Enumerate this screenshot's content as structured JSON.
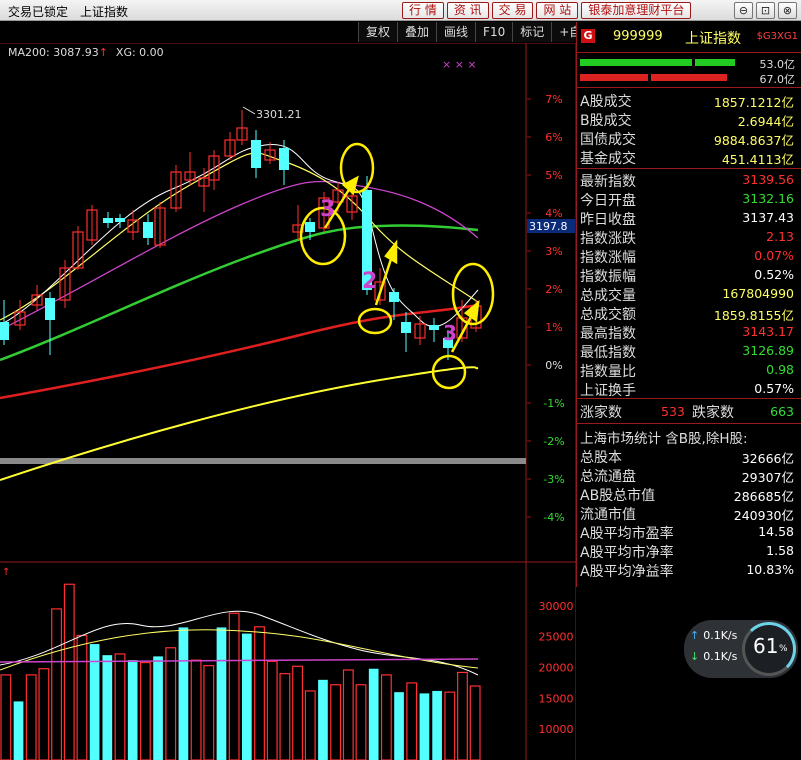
{
  "titlebar": {
    "lock_label": "交易已锁定",
    "window_title": "上证指数",
    "buttons": [
      "行 情",
      "资 讯",
      "交 易",
      "网 站",
      "银泰加意理财平台"
    ],
    "controls": [
      "⊖",
      "⊡",
      "⊗"
    ]
  },
  "toolbar": {
    "items": [
      "复权",
      "叠加",
      "画线",
      "F10",
      "标记",
      "+自选"
    ]
  },
  "ma_legend": {
    "ma200": "MA200: 3087.93",
    "ma200_arrow": "↑",
    "xg": "XG: 0.00"
  },
  "price_chart": {
    "y_labels": [
      "7%",
      "6%",
      "5%",
      "4%",
      "3%",
      "2%",
      "1%",
      "0%",
      "-1%",
      "-2%",
      "-3%",
      "-4%"
    ],
    "y_values": [
      7,
      6,
      5,
      4,
      3,
      2,
      1,
      0,
      -1,
      -2,
      -3,
      -4
    ],
    "high_label": "3301.21",
    "current_marker": "3197.8",
    "annotations": [
      "3",
      "2",
      "3"
    ],
    "markers": "× × ×",
    "colors": {
      "up": "#ff3030",
      "down": "#54ffff",
      "ma5": "#ffffff",
      "ma10": "#ffff66",
      "ma20": "#cc44cc",
      "ma60": "#33cc33",
      "ma120": "#e02020",
      "ma200": "#ffff33",
      "annotation": "#ffee00"
    }
  },
  "chart_data": [
    {
      "type": "bar",
      "title": "",
      "y_axis_ticks": [
        "30000",
        "25000",
        "20000",
        "15000",
        "10000"
      ],
      "ylim": [
        5000,
        35000
      ],
      "values": [
        18800,
        14500,
        18800,
        19800,
        29500,
        33500,
        25200,
        23800,
        22000,
        22200,
        21200,
        20800,
        21800,
        23200,
        26500,
        21200,
        20300,
        26500,
        28800,
        25500,
        26600,
        21000,
        19000,
        20200,
        16200,
        18000,
        17200,
        19600,
        17200,
        19800,
        18800,
        16000,
        17500,
        15800,
        16200,
        16000,
        19200,
        17000
      ],
      "colors": [
        "up",
        "down",
        "up",
        "up",
        "up",
        "up",
        "up",
        "down",
        "down",
        "up",
        "down",
        "up",
        "down",
        "up",
        "down",
        "up",
        "up",
        "down",
        "up",
        "down",
        "up",
        "up",
        "up",
        "up",
        "up",
        "down",
        "up",
        "up",
        "up",
        "down",
        "up",
        "down",
        "up",
        "down",
        "down",
        "up",
        "up",
        "up"
      ],
      "grid": false
    }
  ],
  "right_panel": {
    "code": "999999",
    "name": "上证指数",
    "badge": "G",
    "tag": "$G3XG1",
    "bar_values": [
      "53.0亿",
      "67.0亿"
    ],
    "rows_a": [
      {
        "label": "A股成交",
        "value": "1857.1212亿",
        "color": "#ffff66"
      },
      {
        "label": "B股成交",
        "value": "2.6944亿",
        "color": "#ffff66"
      },
      {
        "label": "国债成交",
        "value": "9884.8637亿",
        "color": "#ffff66"
      },
      {
        "label": "基金成交",
        "value": "451.4113亿",
        "color": "#ffff66"
      }
    ],
    "rows_b": [
      {
        "label": "最新指数",
        "value": "3139.56",
        "color": "#ff3030"
      },
      {
        "label": "今日开盘",
        "value": "3132.16",
        "color": "#33dd33"
      },
      {
        "label": "昨日收盘",
        "value": "3137.43",
        "color": "#ffffff"
      },
      {
        "label": "指数涨跌",
        "value": "2.13",
        "color": "#ff3030"
      },
      {
        "label": "指数涨幅",
        "value": "0.07%",
        "color": "#ff3030"
      },
      {
        "label": "指数振幅",
        "value": "0.52%",
        "color": "#ffffff"
      },
      {
        "label": "总成交量",
        "value": "167804990",
        "color": "#ffff66"
      },
      {
        "label": "总成交额",
        "value": "1859.8155亿",
        "color": "#ffff66"
      },
      {
        "label": "最高指数",
        "value": "3143.17",
        "color": "#ff3030"
      },
      {
        "label": "最低指数",
        "value": "3126.89",
        "color": "#33dd33"
      },
      {
        "label": "指数量比",
        "value": "0.98",
        "color": "#33dd33"
      },
      {
        "label": "上证换手",
        "value": "0.57%",
        "color": "#ffffff"
      }
    ],
    "advance_label": "涨家数",
    "advance_value": "533",
    "decline_label": "跌家数",
    "decline_value": "663",
    "market_title": "上海市场统计 含B股,除H股:",
    "rows_c": [
      {
        "label": "总股本",
        "value": "32666亿",
        "color": "#ffffff"
      },
      {
        "label": "总流通盘",
        "value": "29307亿",
        "color": "#ffffff"
      },
      {
        "label": "AB股总市值",
        "value": "286685亿",
        "color": "#ffffff"
      },
      {
        "label": "流通市值",
        "value": "240930亿",
        "color": "#ffffff"
      },
      {
        "label": "A股平均市盈率",
        "value": "14.58",
        "color": "#ffffff"
      },
      {
        "label": "A股平均市净率",
        "value": "1.58",
        "color": "#ffffff"
      },
      {
        "label": "A股平均净益率",
        "value": "10.83%",
        "color": "#ffffff"
      }
    ]
  },
  "speed_widget": {
    "upload": "0.1K/s",
    "download": "0.1K/s",
    "percent": "61",
    "percent_sign": "%"
  }
}
